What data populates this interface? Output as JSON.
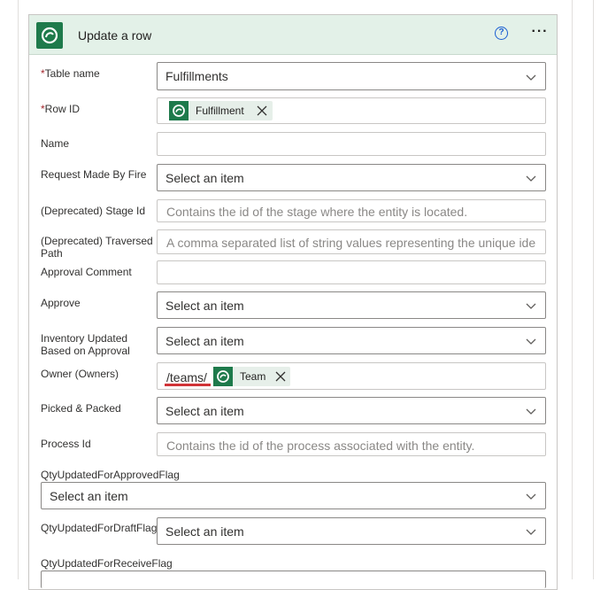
{
  "card": {
    "title": "Update a row"
  },
  "fields": {
    "table_name": {
      "label": "Table name",
      "required": true,
      "value": "Fulfillments"
    },
    "row_id": {
      "label": "Row ID",
      "required": true,
      "token": "Fulfillment"
    },
    "name": {
      "label": "Name",
      "value": ""
    },
    "request_made_by_fire": {
      "label": "Request Made By Fire",
      "value": "Select an item"
    },
    "stage_id": {
      "label": "(Deprecated) Stage Id",
      "placeholder": "Contains the id of the stage where the entity is located."
    },
    "traversed_path": {
      "label_line1": "(Deprecated) Traversed",
      "label_line2": "Path",
      "placeholder": "A comma separated list of string values representing the unique ide"
    },
    "approval_comment": {
      "label": "Approval Comment",
      "value": ""
    },
    "approve": {
      "label": "Approve",
      "value": "Select an item"
    },
    "inventory_updated": {
      "label_line1": "Inventory Updated",
      "label_line2": "Based on Approval",
      "value": "Select an item"
    },
    "owner": {
      "label": "Owner (Owners)",
      "prefix": "/teams/",
      "token": "Team"
    },
    "picked_packed": {
      "label": "Picked & Packed",
      "value": "Select an item"
    },
    "process_id": {
      "label": "Process Id",
      "placeholder": "Contains the id of the process associated with the entity."
    },
    "qty_approved_flag": {
      "label": "QtyUpdatedForApprovedFlag",
      "value": "Select an item"
    },
    "qty_draft_flag": {
      "label": "QtyUpdatedForDraftFlag",
      "value": "Select an item"
    },
    "qty_receive_flag": {
      "label": "QtyUpdatedForReceiveFlag",
      "value": ""
    }
  },
  "icons": {
    "app": "dataverse-icon",
    "help": "help-circle-icon",
    "more": "ellipsis-icon",
    "chevron": "chevron-down-icon",
    "remove": "close-icon"
  },
  "colors": {
    "header_bg": "#e3f1e8",
    "dataverse_green": "#1e7a4b",
    "required": "#a4262c",
    "help_blue": "#1a5fd2",
    "spell_error": "#d13438"
  },
  "help_glyph": "?",
  "more_glyph": "···"
}
